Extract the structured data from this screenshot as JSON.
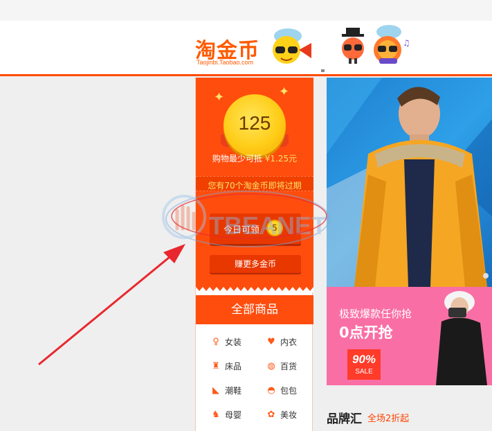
{
  "header": {
    "logo_cn": "淘金币",
    "logo_en": "Taojinbi.Taobao.com"
  },
  "coin_panel": {
    "balance": "125",
    "deduct_prefix": "购物最少可抵 ",
    "deduct_amount": "¥1.25元",
    "expire_notice": "您有70个淘金币即将过期",
    "today_label": "今日可领",
    "today_amount": "5",
    "earn_more": "赚更多金币"
  },
  "categories": {
    "header": "全部商品",
    "items": [
      {
        "label": "女装",
        "icon": "dress-icon"
      },
      {
        "label": "内衣",
        "icon": "lingerie-icon"
      },
      {
        "label": "床品",
        "icon": "lamp-icon"
      },
      {
        "label": "百货",
        "icon": "tissue-roll-icon"
      },
      {
        "label": "潮鞋",
        "icon": "high-heel-icon"
      },
      {
        "label": "包包",
        "icon": "handbag-icon"
      },
      {
        "label": "母婴",
        "icon": "rocking-horse-icon"
      },
      {
        "label": "美妆",
        "icon": "makeup-icon"
      }
    ]
  },
  "banners": {
    "promo_title": "极致爆款任你抢",
    "promo_subtitle": "0点开抢",
    "promo_pct": "90%",
    "promo_sale": "SALE"
  },
  "brand": {
    "title": "品牌汇",
    "subtitle": "全场2折起"
  },
  "watermark": {
    "text": "TBEANET"
  },
  "colors": {
    "accent": "#ff4d0e",
    "gold": "#ffcd18",
    "banner_pink": "#f96fa5",
    "arrow": "#e8282e"
  }
}
